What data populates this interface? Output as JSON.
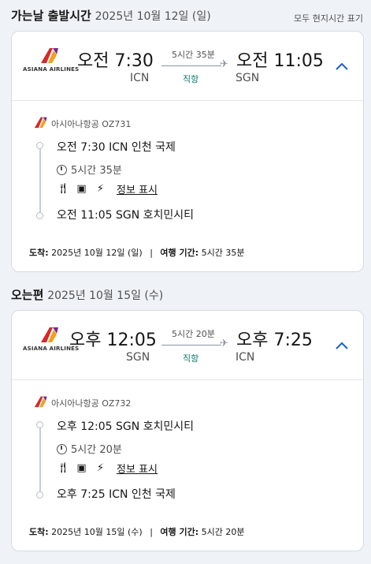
{
  "outbound": {
    "header_bold": "가는날 출발시간",
    "header_date": "2025년 10월 12일 (일)",
    "timezone_note": "모두 현지시간 표기",
    "logo_text": "ASIANA AIRLINES",
    "dep_time": "오전 7:30",
    "dep_code": "ICN",
    "duration": "5시간 35분",
    "direct": "직항",
    "arr_time": "오전 11:05",
    "arr_code": "SGN",
    "airline_flight": "아시아나항공 OZ731",
    "dep_detail": "오전 7:30 ICN 인천 국제",
    "duration_detail": "5시간 35분",
    "amenities_link": "정보 표시",
    "arr_detail": "오전 11:05 SGN 호치민시티",
    "arrival_label": "도착:",
    "arrival_value": "2025년 10월 12일 (일)",
    "separator": "|",
    "travel_label": "여행 기간:",
    "travel_value": "5시간 35분"
  },
  "inbound": {
    "header_bold": "오는편",
    "header_date": "2025년 10월 15일 (수)",
    "logo_text": "ASIANA AIRLINES",
    "dep_time": "오후 12:05",
    "dep_code": "SGN",
    "duration": "5시간 20분",
    "direct": "직항",
    "arr_time": "오후 7:25",
    "arr_code": "ICN",
    "airline_flight": "아시아나항공 OZ732",
    "dep_detail": "오후 12:05 SGN 호치민시티",
    "duration_detail": "5시간 20분",
    "amenities_link": "정보 표시",
    "arr_detail": "오후 7:25 ICN 인천 국제",
    "arrival_label": "도착:",
    "arrival_value": "2025년 10월 15일 (수)",
    "separator": "|",
    "travel_label": "여행 기간:",
    "travel_value": "5시간 20분"
  },
  "icons": [
    "meal-icon",
    "entertainment-icon",
    "power-icon",
    "clock-icon",
    "plane-icon",
    "chevron-up-icon",
    "airline-logo-icon"
  ],
  "colors": {
    "background": "#eff3f8",
    "card": "#ffffff",
    "direct_green": "#0a7a6c",
    "chevron_blue": "#1a5fd0",
    "logo_red": "#d52a2a",
    "logo_orange": "#f2a01d"
  }
}
